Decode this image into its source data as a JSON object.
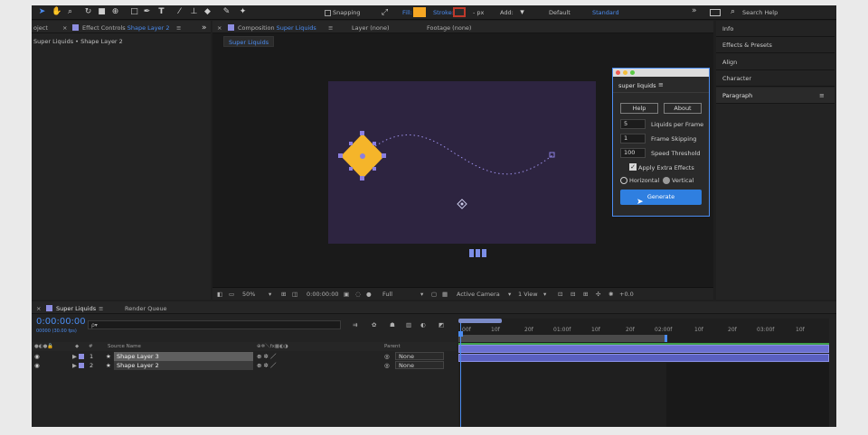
{
  "toolbar": {
    "snapping_label": "Snapping",
    "fill_label": "Fill:",
    "stroke_label": "Stroke:",
    "stroke_px": "- px",
    "add_label": "Add:",
    "workspace_default": "Default",
    "workspace_standard": "Standard",
    "more": "»",
    "search_placeholder": "Search Help",
    "fill_color": "#f5a623",
    "stroke_color": "#c0392b"
  },
  "left_panel": {
    "tab_project": "oject",
    "tab_effect_controls": "Effect Controls",
    "tab_effect_controls_target": "Shape Layer 2",
    "breadcrumb": "Super Liquids • Shape Layer 2"
  },
  "comp_panel": {
    "tab_composition": "Composition",
    "tab_composition_name": "Super Liquids",
    "tab_layer": "Layer (none)",
    "tab_footage": "Footage (none)",
    "sub_tab": "Super Liquids",
    "bottom": {
      "zoom": "50%",
      "timecode": "0:00:00:00",
      "resolution": "Full",
      "camera": "Active Camera",
      "views": "1 View",
      "exposure": "+0.0"
    }
  },
  "plugin": {
    "title": "super liquids",
    "help_button": "Help",
    "about_button": "About",
    "fields": [
      {
        "value": "5",
        "label": "Liquids per Frame"
      },
      {
        "value": "1",
        "label": "Frame Skipping"
      },
      {
        "value": "100",
        "label": "Speed Threshold"
      }
    ],
    "apply_extra_label": "Apply Extra Effects",
    "radio_horizontal": "Horizontal",
    "radio_vertical": "Vertical",
    "generate_button": "Generate"
  },
  "right_panel": {
    "items": [
      "Info",
      "Effects & Presets",
      "Align",
      "Character",
      "Paragraph"
    ]
  },
  "timeline": {
    "tab_comp": "Super Liquids",
    "tab_render": "Render Queue",
    "timecode": "0:00:00:00",
    "fps": "00000 (30.00 fps)",
    "search_placeholder": "ρ▾",
    "col_source": "Source Name",
    "col_parent": "Parent",
    "layers": [
      {
        "num": "1",
        "name": "Shape Layer 3",
        "parent": "None",
        "color": "#8e8ee0"
      },
      {
        "num": "2",
        "name": "Shape Layer 2",
        "parent": "None",
        "color": "#8e8ee0"
      }
    ],
    "ruler": [
      "00f",
      "10f",
      "20f",
      "01:00f",
      "10f",
      "20f",
      "02:00f",
      "10f",
      "20f",
      "03:00f",
      "10f"
    ]
  },
  "colors": {
    "accent": "#4b8cf0",
    "comp_bg": "#2d2440",
    "shape_fill": "#f5b52a",
    "handle": "#8b7fe0",
    "generate": "#2f7fe0",
    "track": "#6a6fd0"
  }
}
